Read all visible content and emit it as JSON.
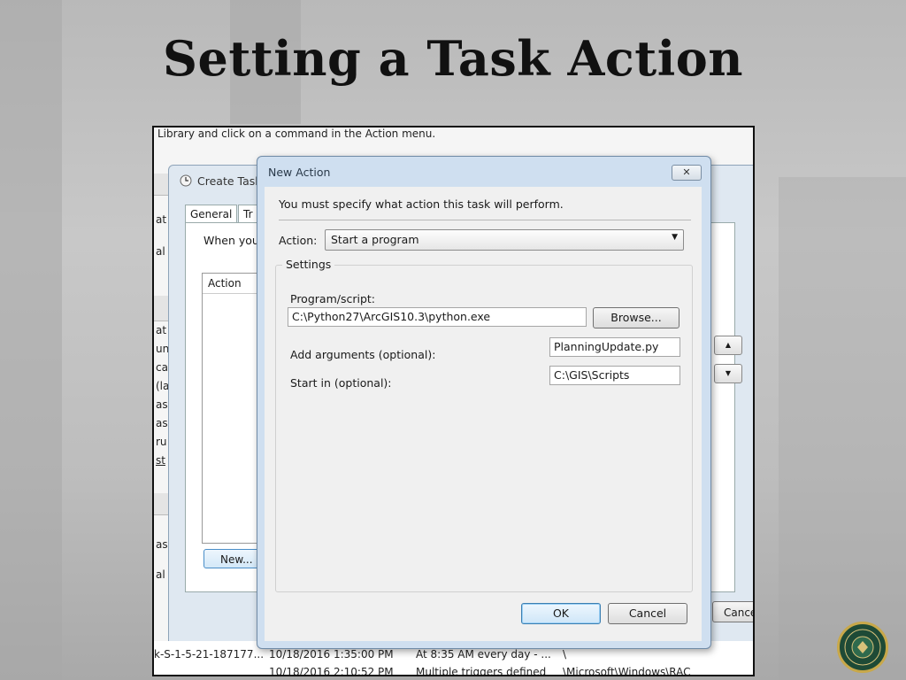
{
  "slide": {
    "title": "Setting a Task Action"
  },
  "screenshot": {
    "top_text": "Library and click on a command in the Action menu.",
    "left_fragments": [
      "at I",
      "al -",
      "at",
      "unn",
      "cati",
      "(la",
      "ask",
      "ask",
      "ru",
      "st",
      "ask",
      "al"
    ],
    "create_task": {
      "title": "Create Task",
      "tabs": [
        "General",
        "Tr"
      ],
      "when_text": "When you",
      "list_header": "Action",
      "new_button": "New...",
      "cancel_button": "Cance"
    },
    "task_rows": [
      {
        "author": "k-S-1-5-21-187177...",
        "date": "10/18/2016 1:35:00 PM",
        "trigger": "At 8:35 AM every day - ...",
        "path": "\\"
      },
      {
        "author": "",
        "date": "10/18/2016 2:10:52 PM",
        "trigger": "Multiple triggers defined",
        "path": "\\Microsoft\\Windows\\RAC"
      }
    ]
  },
  "new_action": {
    "title": "New Action",
    "close_label": "✕",
    "instruction": "You must specify what action this task will perform.",
    "action_label": "Action:",
    "action_value": "Start a program",
    "settings_label": "Settings",
    "program_label": "Program/script:",
    "program_value": "C:\\Python27\\ArcGIS10.3\\python.exe",
    "browse_button": "Browse...",
    "args_label": "Add arguments (optional):",
    "args_value": "PlanningUpdate.py",
    "startin_label": "Start in (optional):",
    "startin_value": "C:\\GIS\\Scripts",
    "ok_button": "OK",
    "cancel_button": "Cancel"
  },
  "icons": {
    "clock": "clock-icon",
    "seal": "county-seal-icon",
    "dropdown": "chevron-down-icon"
  }
}
